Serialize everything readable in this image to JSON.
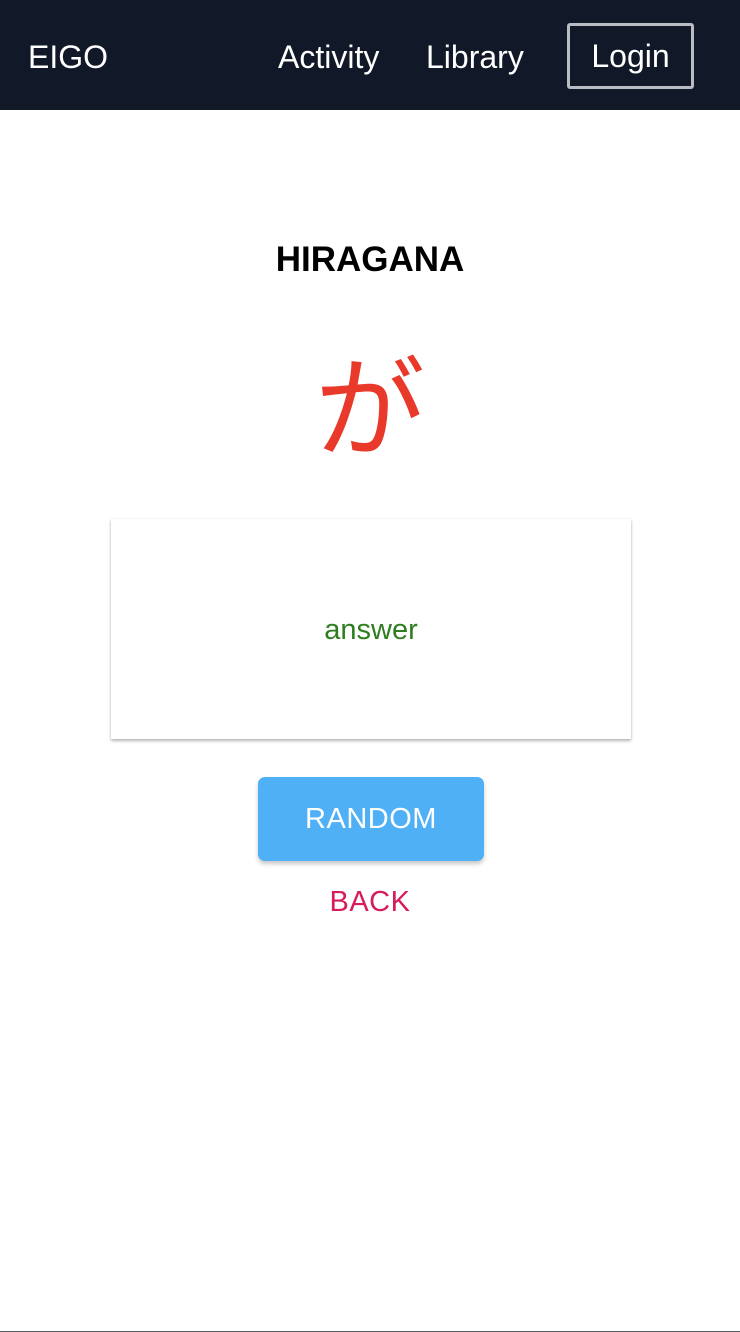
{
  "navbar": {
    "brand": "EIGO",
    "links": [
      {
        "label": "Activity"
      },
      {
        "label": "Library"
      }
    ],
    "login_label": "Login"
  },
  "main": {
    "title": "HIRAGANA",
    "character": "が",
    "answer_label": "answer",
    "random_label": "RANDOM",
    "back_label": "BACK"
  },
  "colors": {
    "navbar_bg": "#111827",
    "character": "#e8392a",
    "answer": "#2e7d1f",
    "random_button": "#4fb0f6",
    "back_link": "#d81b5a"
  }
}
